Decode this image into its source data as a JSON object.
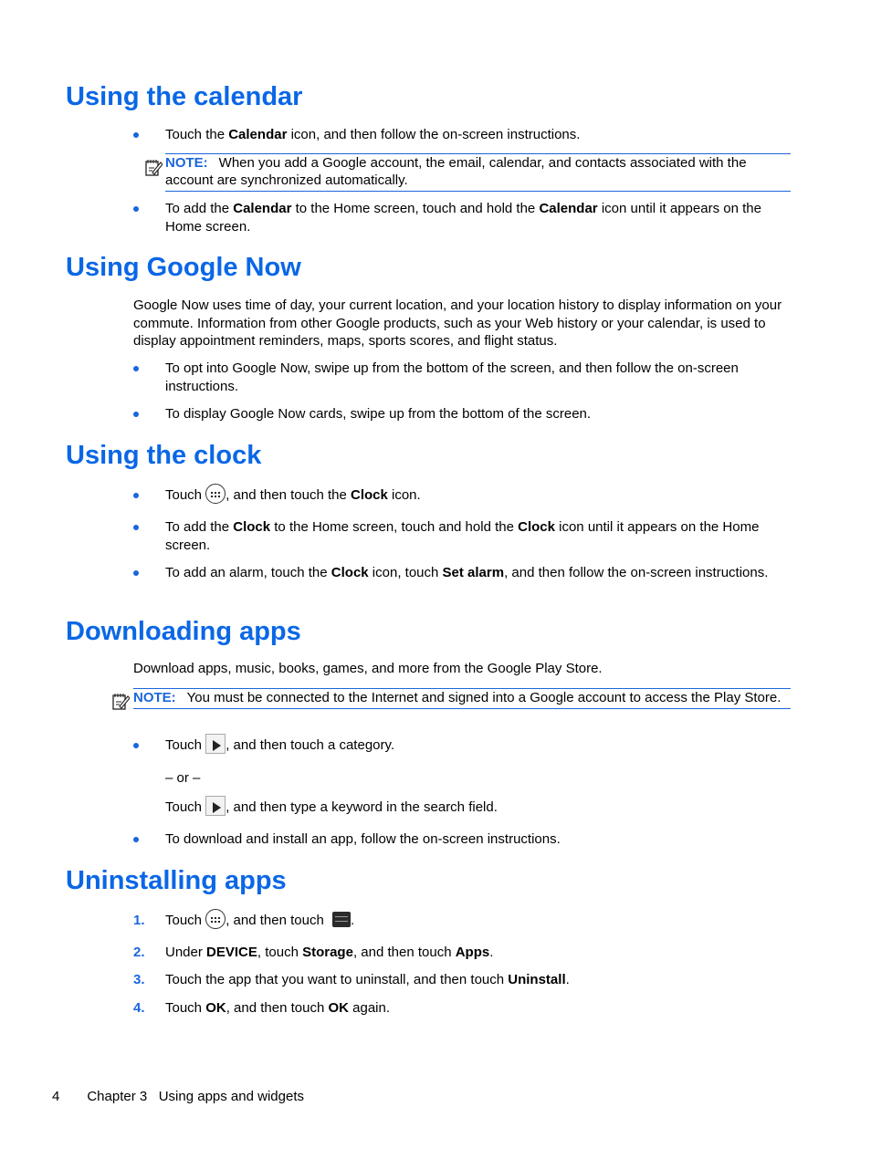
{
  "sections": {
    "calendar": {
      "title": "Using the calendar",
      "bullet1": {
        "a": "Touch the ",
        "b": "Calendar",
        "c": " icon, and then follow the on-screen instructions."
      },
      "note": {
        "label": "NOTE:",
        "text": "When you add a Google account, the email, calendar, and contacts associated with the account are synchronized automatically."
      },
      "bullet2": {
        "a": "To add the ",
        "b": "Calendar",
        "c": " to the Home screen, touch and hold the ",
        "d": "Calendar",
        "e": " icon until it appears on the Home screen."
      }
    },
    "google_now": {
      "title": "Using Google Now",
      "intro": "Google Now uses time of day, your current location, and your location history to display information on your commute. Information from other Google products, such as your Web history or your calendar, is used to display appointment reminders, maps, sports scores, and flight status.",
      "bullet1": "To opt into Google Now, swipe up from the bottom of the screen, and then follow the on-screen instructions.",
      "bullet2": "To display Google Now cards, swipe up from the bottom of the screen."
    },
    "clock": {
      "title": "Using the clock",
      "bullet1": {
        "a": "Touch ",
        "b": ", and then touch the ",
        "c": "Clock",
        "d": " icon."
      },
      "bullet2": {
        "a": "To add the ",
        "b": "Clock",
        "c": " to the Home screen, touch and hold the ",
        "d": "Clock",
        "e": " icon until it appears on the Home screen."
      },
      "bullet3": {
        "a": "To add an alarm, touch the ",
        "b": "Clock",
        "c": " icon, touch ",
        "d": "Set alarm",
        "e": ", and then follow the on-screen instructions."
      }
    },
    "downloading": {
      "title": "Downloading apps",
      "intro": "Download apps, music, books, games, and more from the Google Play Store.",
      "note": {
        "label": "NOTE:",
        "text": "You must be connected to the Internet and signed into a Google account to access the Play Store."
      },
      "bullet1": {
        "a": "Touch ",
        "b": ", and then touch a category."
      },
      "or": "– or –",
      "alt": {
        "a": "Touch ",
        "b": ", and then type a keyword in the search field."
      },
      "bullet2": "To download and install an app, follow the on-screen instructions."
    },
    "uninstalling": {
      "title": "Uninstalling apps",
      "steps": [
        {
          "n": "1.",
          "a": "Touch ",
          "b": ", and then touch ",
          "c": "."
        },
        {
          "n": "2.",
          "a": "Under ",
          "b": "DEVICE",
          "c": ", touch ",
          "d": "Storage",
          "e": ", and then touch ",
          "f": "Apps",
          "g": "."
        },
        {
          "n": "3.",
          "a": "Touch the app that you want to uninstall, and then touch ",
          "b": "Uninstall",
          "c": "."
        },
        {
          "n": "4.",
          "a": "Touch ",
          "b": "OK",
          "c": ", and then touch ",
          "d": "OK",
          "e": " again."
        }
      ]
    }
  },
  "footer": {
    "page": "4",
    "chapter": "Chapter 3   Using apps and widgets"
  }
}
